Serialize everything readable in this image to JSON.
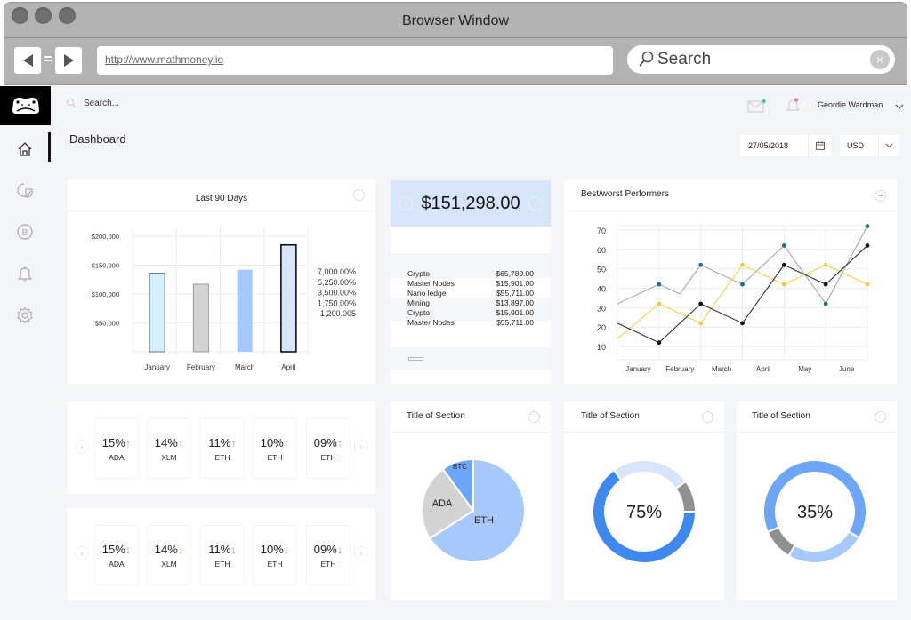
{
  "browser": {
    "window_title": "Browser Window",
    "url": "http://www.mathmoney.io",
    "search_label": "Search",
    "clear_icon": "×"
  },
  "header": {
    "search_placeholder": "Search...",
    "user_name": "Geordie Wardman",
    "mail_indicator_color": "#4cc3a0",
    "bell_indicator_color": "#f08080"
  },
  "sidebar": {
    "items": [
      {
        "name": "home",
        "active": true
      },
      {
        "name": "portfolio"
      },
      {
        "name": "bitcoin"
      },
      {
        "name": "notifications"
      },
      {
        "name": "settings"
      }
    ]
  },
  "page": {
    "title": "Dashboard",
    "date": "27/05/2018",
    "currency": "USD"
  },
  "balance": {
    "total": "$151,298.00",
    "rows": [
      {
        "label": "Crypto",
        "value": "$65,789.00"
      },
      {
        "label": "Master Nodes",
        "value": "$15,901.00"
      },
      {
        "label": "Nano ledge",
        "value": "$55,711.00"
      },
      {
        "label": "Mining",
        "value": "$13,897.00"
      },
      {
        "label": "Crypto",
        "value": "$15,901.00"
      },
      {
        "label": "Master Nodes",
        "value": "$55,711.00"
      }
    ]
  },
  "gainers": [
    {
      "pct": "15%",
      "symbol": "ADA",
      "arrow": "↑"
    },
    {
      "pct": "14%",
      "symbol": "XLM",
      "arrow": "↑"
    },
    {
      "pct": "11%",
      "symbol": "ETH",
      "arrow": "↑"
    },
    {
      "pct": "10%",
      "symbol": "ETH",
      "arrow": "↑"
    },
    {
      "pct": "09%",
      "symbol": "ETH",
      "arrow": "↑"
    }
  ],
  "losers": [
    {
      "pct": "15%",
      "symbol": "ADA",
      "arrow": "↓"
    },
    {
      "pct": "14%",
      "symbol": "XLM",
      "arrow": "↓"
    },
    {
      "pct": "11%",
      "symbol": "ETH",
      "arrow": "↓"
    },
    {
      "pct": "10%",
      "symbol": "ETH",
      "arrow": "↓"
    },
    {
      "pct": "09%",
      "symbol": "ETH",
      "arrow": "↓"
    }
  ],
  "chart_data": [
    {
      "type": "bar",
      "title": "Last 90 Days",
      "categories": [
        "January",
        "February",
        "March",
        "April"
      ],
      "values": [
        136000,
        117000,
        142000,
        185000
      ],
      "ylim": [
        0,
        200000
      ],
      "yticks": [
        "$200,000",
        "$150,000",
        "$100,000",
        "$50,000"
      ],
      "ytick_values": [
        200000,
        150000,
        100000,
        50000
      ],
      "colors": [
        "#d4efff",
        "#d3d3d3",
        "#a6c8fb",
        "#d6e4fc"
      ],
      "strokes": [
        "#5f7380",
        "#9a9a9a",
        "none",
        "#111111"
      ],
      "side_labels": [
        "7,000.00%",
        "5,250.00%",
        "3,500.00%",
        "1,750.00%",
        "1,200.005"
      ],
      "grid": true
    },
    {
      "type": "line",
      "title": "Best/worst Performers",
      "categories": [
        "January",
        "February",
        "March",
        "April",
        "May",
        "June"
      ],
      "ylim": [
        5,
        75
      ],
      "yticks": [
        70,
        60,
        50,
        40,
        30,
        20,
        10
      ],
      "series": [
        {
          "name": "gray",
          "color": "#a8a8a8",
          "dot_color": "#1f6f93",
          "x": [
            0,
            1,
            1.5,
            2,
            3,
            4,
            5,
            6
          ],
          "values": [
            32,
            42,
            37,
            52,
            42,
            62,
            32,
            72
          ],
          "dots": [
            false,
            true,
            false,
            true,
            true,
            true,
            true,
            true
          ]
        },
        {
          "name": "yellow",
          "color": "#f0cf55",
          "dot_color": "#f0c93c",
          "x": [
            0,
            1,
            2,
            3,
            4,
            5,
            6
          ],
          "values": [
            14,
            32,
            22,
            52,
            42,
            52,
            42
          ],
          "dots": [
            false,
            true,
            true,
            true,
            true,
            true,
            true
          ]
        },
        {
          "name": "black",
          "color": "#333333",
          "dot_color": "#111111",
          "x": [
            0,
            1,
            2,
            3,
            4,
            5,
            6
          ],
          "values": [
            22,
            12,
            32,
            22,
            52,
            42,
            62
          ],
          "dots": [
            false,
            true,
            true,
            true,
            true,
            true,
            true
          ]
        }
      ],
      "grid": true
    },
    {
      "type": "pie",
      "title": "Title of Section",
      "labels": [
        "ETH",
        "ADA",
        "BTC"
      ],
      "values": [
        66,
        24,
        10
      ],
      "colors": [
        "#a6c8fb",
        "#d3d3d3",
        "#6ea6f7"
      ]
    },
    {
      "type": "pie",
      "title": "Title of Section",
      "center_label": "75%",
      "labels": [
        "primary",
        "light",
        "gray"
      ],
      "values": [
        65,
        25,
        10
      ],
      "colors": [
        "#3f88f0",
        "#d6e4fc",
        "#909090"
      ],
      "donut": true
    },
    {
      "type": "pie",
      "title": "Title of Section",
      "center_label": "35%",
      "labels": [
        "primary",
        "light",
        "gray"
      ],
      "values": [
        65,
        25,
        10
      ],
      "colors": [
        "#6ea6f7",
        "#a6c8fb",
        "#909090"
      ],
      "donut": true
    }
  ]
}
